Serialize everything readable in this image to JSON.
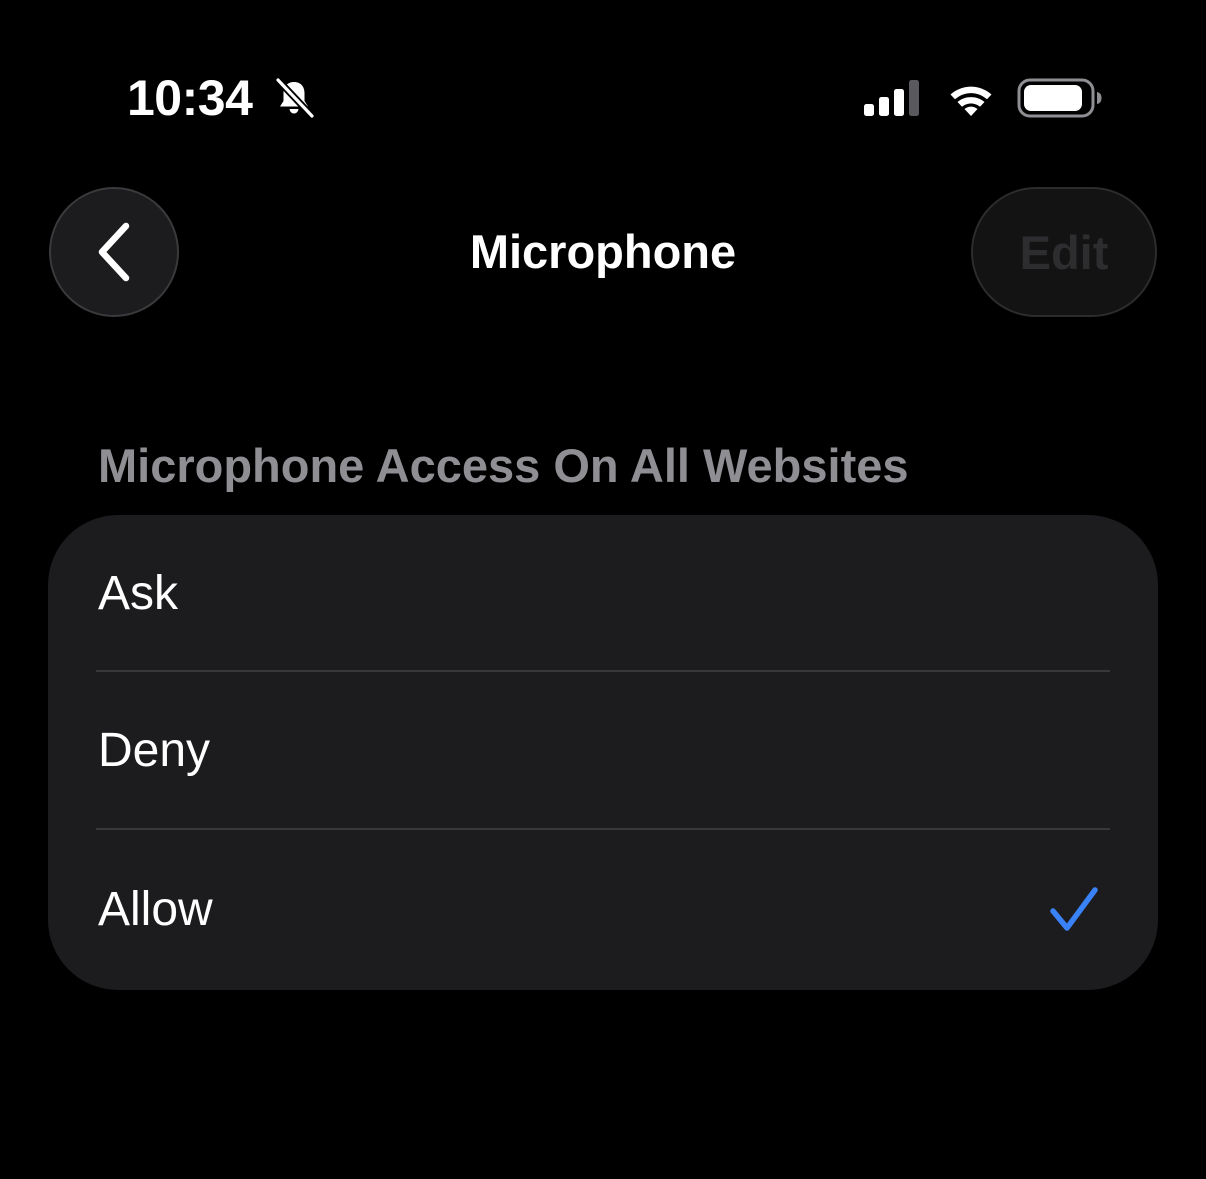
{
  "status_bar": {
    "time": "10:34",
    "icons": [
      "bell-slash-icon",
      "cellular-signal-icon",
      "wifi-icon",
      "battery-icon"
    ]
  },
  "nav": {
    "back_icon": "chevron-left-icon",
    "title": "Microphone",
    "edit_label": "Edit"
  },
  "section": {
    "header": "Microphone Access On All Websites",
    "options": [
      {
        "label": "Ask",
        "selected": false
      },
      {
        "label": "Deny",
        "selected": false
      },
      {
        "label": "Allow",
        "selected": true
      }
    ]
  },
  "colors": {
    "background": "#000000",
    "cell": "#1c1c1e",
    "secondary_text": "#8e8e93",
    "accent": "#3a82f7",
    "disabled_text": "#2d2d30"
  }
}
